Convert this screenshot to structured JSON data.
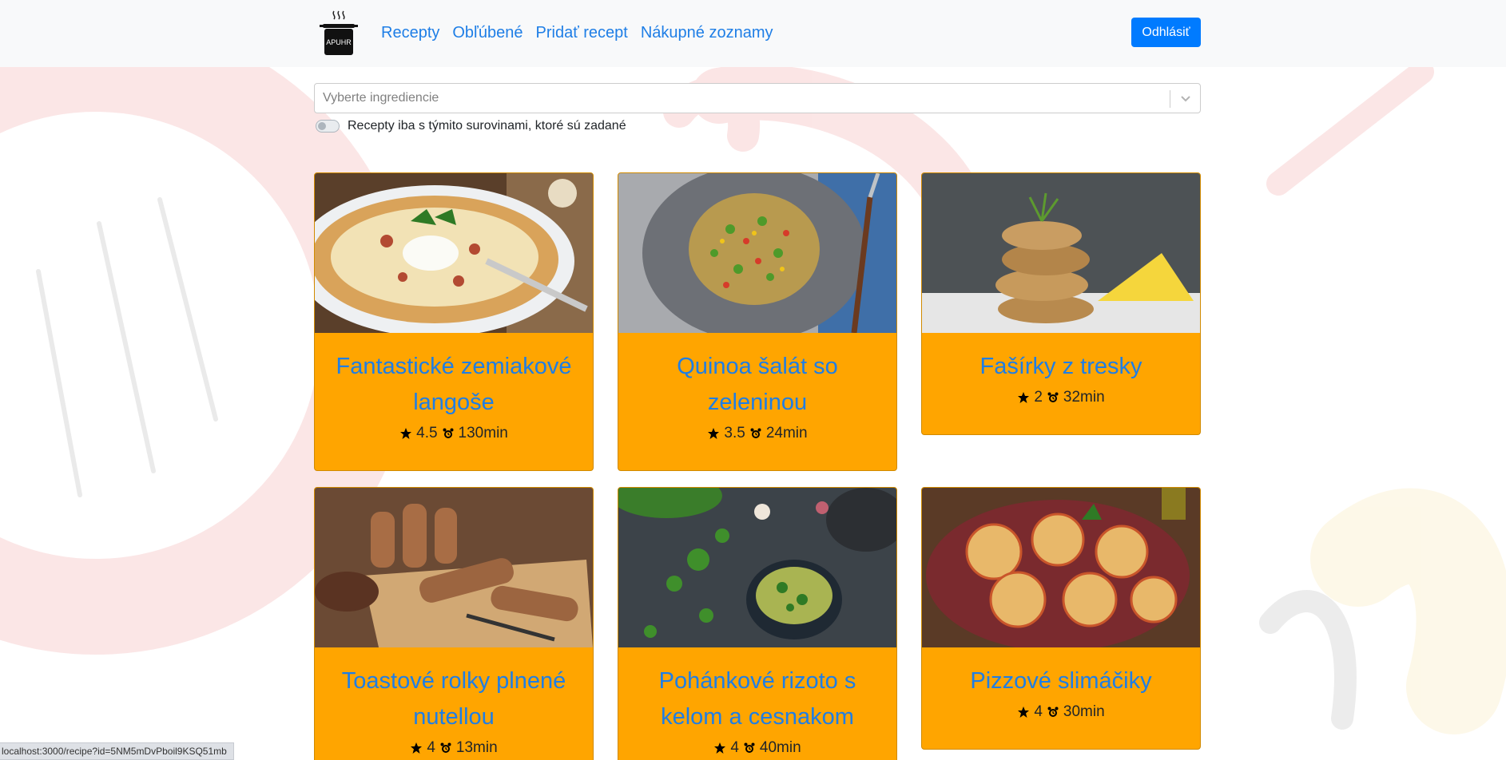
{
  "header": {
    "logo_text": "APUHR",
    "nav_links": [
      "Recepty",
      "Obľúbené",
      "Pridať recept",
      "Nákupné zoznamy"
    ],
    "logout_label": "Odhlásiť"
  },
  "filter": {
    "placeholder": "Vyberte ingrediencie",
    "toggle_label": "Recepty iba s týmito surovinami, ktoré sú zadané",
    "toggle_on": false
  },
  "recipes": [
    {
      "title": "Fantastické zemiakové langoše",
      "rating": "4.5",
      "time": "130min",
      "image": "langos-photo"
    },
    {
      "title": "Quinoa šalát so zeleninou",
      "rating": "3.5",
      "time": "24min",
      "image": "quinoa-salad-photo"
    },
    {
      "title": "Fašírky z tresky",
      "rating": "2",
      "time": "32min",
      "image": "cod-patties-photo"
    },
    {
      "title": "Toastové rolky plnené nutellou",
      "rating": "4",
      "time": "13min",
      "image": "toast-rolls-photo"
    },
    {
      "title": "Pohánkové rizoto s kelom a cesnakom",
      "rating": "4",
      "time": "40min",
      "image": "buckwheat-risotto-photo"
    },
    {
      "title": "Pizzové slimáčiky",
      "rating": "4",
      "time": "30min",
      "image": "pizza-snails-photo"
    }
  ],
  "status_url": "localhost:3000/recipe?id=5NM5mDvPboil9KSQ51mb",
  "colors": {
    "card_bg": "#ffa500",
    "link": "#1e7ee6",
    "button": "#007bff",
    "navbar_bg": "#f8f9fa"
  }
}
